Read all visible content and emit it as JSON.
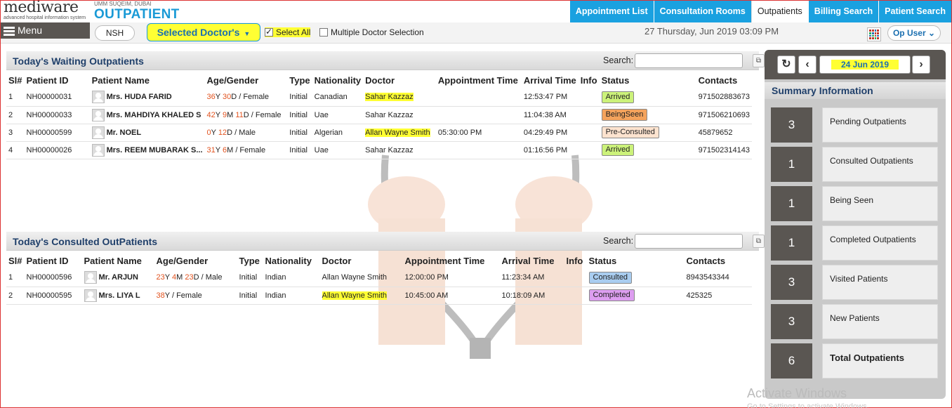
{
  "header": {
    "logo_text": "mediware",
    "logo_tagline": "advanced hospital information system",
    "org": "UMM SUQEIM, DUBAI",
    "module_title": "OUTPATIENT",
    "nav_tabs": [
      {
        "label": "Appointment List"
      },
      {
        "label": "Consultation Rooms"
      },
      {
        "label": "Outpatients"
      },
      {
        "label": "Billing Search"
      },
      {
        "label": "Patient Search"
      }
    ]
  },
  "toolbar": {
    "menu_label": "Menu",
    "nsh_label": "NSH",
    "doctor_select_label": "Selected Doctor's",
    "select_all_label": "Select All",
    "multiple_doctor_label": "Multiple Doctor Selection",
    "datetime": "27 Thursday, Jun 2019  03:09 PM",
    "user_label": "Op User"
  },
  "waiting": {
    "title": "Today's Waiting Outpatients",
    "search_label": "Search:",
    "search_value": "",
    "columns": [
      "Sl#",
      "Patient ID",
      "Patient Name",
      "Age/Gender",
      "Type",
      "Nationality",
      "Doctor",
      "Appointment Time",
      "Arrival Time",
      "Info",
      "Status",
      "Contacts"
    ],
    "rows": [
      {
        "sl": "1",
        "pid": "NH00000031",
        "name": "Mrs. HUDA FARID",
        "age_y": "36",
        "age_m": "",
        "age_d": "30",
        "gender": "Female",
        "type": "Initial",
        "nationality": "Canadian",
        "doctor": "Sahar Kazzaz",
        "appt": "",
        "arrival": "12:53:47 PM",
        "info": "",
        "status": "Arrived",
        "contacts": "971502883673"
      },
      {
        "sl": "2",
        "pid": "NH00000033",
        "name": "Mrs. MAHDIYA KHALED S",
        "age_y": "42",
        "age_m": "9",
        "age_d": "11",
        "gender": "Female",
        "type": "Initial",
        "nationality": "Uae",
        "doctor": "Sahar Kazzaz",
        "appt": "",
        "arrival": "11:04:38 AM",
        "info": "",
        "status": "BeingSeen",
        "contacts": "971506210693"
      },
      {
        "sl": "3",
        "pid": "NH00000599",
        "name": "Mr. NOEL",
        "age_y": "0",
        "age_m": "",
        "age_d": "12",
        "gender": "Male",
        "type": "Initial",
        "nationality": "Algerian",
        "doctor": "Allan Wayne Smith",
        "appt": "05:30:00 PM",
        "arrival": "04:29:49 PM",
        "info": "",
        "status": "Pre-Consulted",
        "contacts": "45879652"
      },
      {
        "sl": "4",
        "pid": "NH00000026",
        "name": "Mrs. REEM MUBARAK S...",
        "age_y": "31",
        "age_m": "6",
        "age_d": "",
        "gender": "Female",
        "type": "Initial",
        "nationality": "Uae",
        "doctor": "Sahar Kazzaz",
        "appt": "",
        "arrival": "01:16:56 PM",
        "info": "",
        "status": "Arrived",
        "contacts": "971502314143"
      }
    ]
  },
  "consulted": {
    "title": "Today's Consulted OutPatients",
    "search_label": "Search:",
    "search_value": "",
    "columns": [
      "Sl#",
      "Patient ID",
      "Patient Name",
      "Age/Gender",
      "Type",
      "Nationality",
      "Doctor",
      "Appointment Time",
      "Arrival Time",
      "Info",
      "Status",
      "Contacts"
    ],
    "rows": [
      {
        "sl": "1",
        "pid": "NH00000596",
        "name": "Mr. ARJUN",
        "age_y": "23",
        "age_m": "4",
        "age_d": "23",
        "gender": "Male",
        "type": "Initial",
        "nationality": "Indian",
        "doctor": "Allan Wayne Smith",
        "appt": "12:00:00 PM",
        "arrival": "11:23:34 AM",
        "info": "",
        "status": "Consulted",
        "contacts": "8943543344"
      },
      {
        "sl": "2",
        "pid": "NH00000595",
        "name": "Mrs. LIYA L",
        "age_y": "38",
        "age_m": "",
        "age_d": "",
        "gender": "Female",
        "type": "Initial",
        "nationality": "Indian",
        "doctor": "Allan Wayne Smith",
        "appt": "10:45:00 AM",
        "arrival": "10:18:09 AM",
        "info": "",
        "status": "Completed",
        "contacts": "425325"
      }
    ]
  },
  "status_colors": {
    "Arrived": "#ccf27a",
    "BeingSeen": "#f4a35c",
    "Pre-Consulted": "#fde3cf",
    "Consulted": "#a9cdf0",
    "Completed": "#dd9ef0"
  },
  "summary": {
    "date": "24 Jun 2019",
    "title": "Summary Information",
    "items": [
      {
        "count": "3",
        "label": "Pending Outpatients"
      },
      {
        "count": "1",
        "label": "Consulted Outpatients"
      },
      {
        "count": "1",
        "label": "Being Seen"
      },
      {
        "count": "1",
        "label": "Completed Outpatients"
      },
      {
        "count": "3",
        "label": "Visited Patients"
      },
      {
        "count": "3",
        "label": "New Patients"
      },
      {
        "count": "6",
        "label": "Total Outpatients"
      }
    ]
  },
  "watermark": {
    "line1": "Activate Windows",
    "line2": "Go to Settings to activate Windows."
  },
  "colors": {
    "accent": "#1aa1e0",
    "highlight": "#ffff33",
    "dark": "#5a5652"
  }
}
